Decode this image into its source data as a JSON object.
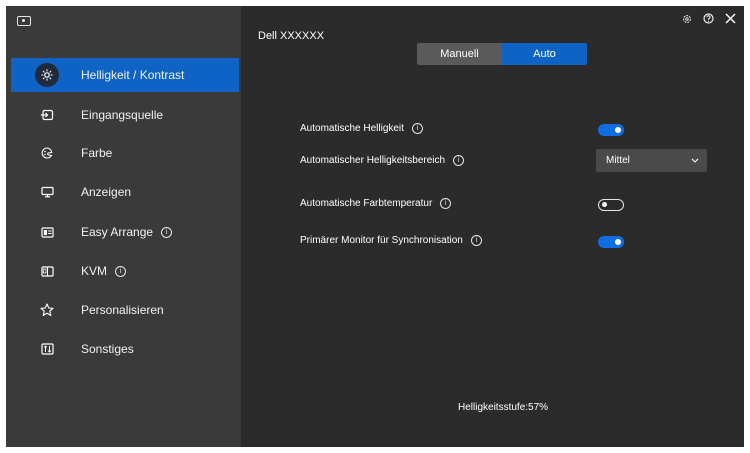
{
  "header": {
    "monitor_name": "Dell XXXXXX"
  },
  "sidebar": {
    "items": [
      {
        "label": "Helligkeit / Kontrast",
        "icon": "brightness-icon",
        "active": true
      },
      {
        "label": "Eingangsquelle",
        "icon": "input-source-icon"
      },
      {
        "label": "Farbe",
        "icon": "color-palette-icon"
      },
      {
        "label": "Anzeigen",
        "icon": "monitor-icon"
      },
      {
        "label": "Easy Arrange",
        "icon": "layout-icon",
        "info": true
      },
      {
        "label": "KVM",
        "icon": "kvm-icon",
        "info": true
      },
      {
        "label": "Personalisieren",
        "icon": "star-icon"
      },
      {
        "label": "Sonstiges",
        "icon": "others-icon"
      }
    ]
  },
  "mode_switch": {
    "manual_label": "Manuell",
    "auto_label": "Auto",
    "selected": "Auto"
  },
  "settings": {
    "auto_brightness": {
      "label": "Automatische Helligkeit",
      "state": "on"
    },
    "auto_brightness_range": {
      "label": "Automatischer Helligkeitsbereich",
      "value": "Mittel"
    },
    "auto_color_temp": {
      "label": "Automatische Farbtemperatur",
      "state": "off"
    },
    "primary_monitor_sync": {
      "label": "Primärer Monitor für Synchronisation",
      "state": "on"
    }
  },
  "status": {
    "brightness_level": "Helligkeitsstufe:57%"
  },
  "colors": {
    "accent": "#0e63c4",
    "sidebar_bg": "#3a3a3a",
    "main_bg": "#2b2b2b"
  }
}
